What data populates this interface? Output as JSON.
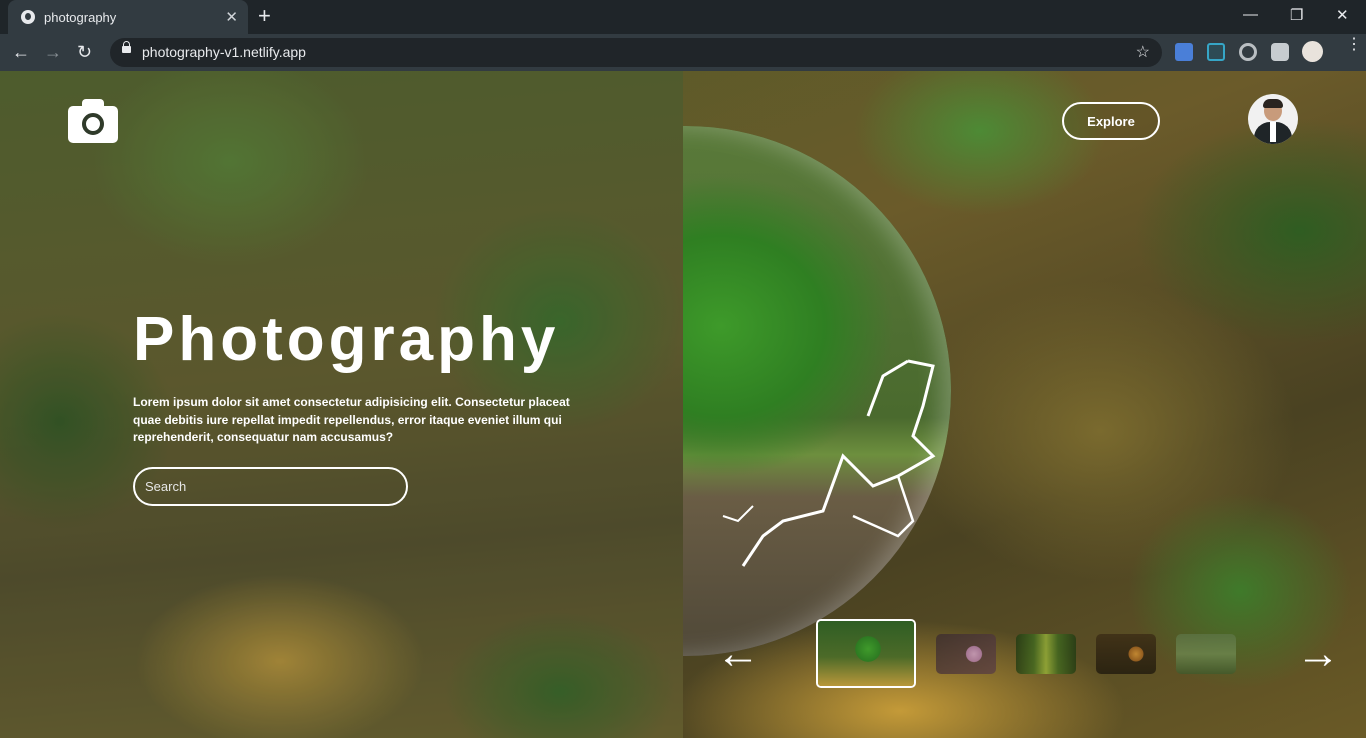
{
  "browser": {
    "tab_title": "photography",
    "url": "photography-v1.netlify.app",
    "new_tab": "+",
    "tab_close": "✕",
    "back": "←",
    "forward": "→",
    "reload": "↻",
    "bookmark": "☆",
    "minimize": "—",
    "restore": "❐",
    "close": "✕"
  },
  "hero": {
    "title": "Photography",
    "description": "Lorem ipsum dolor sit amet consectetur adipisicing elit. Consectetur placeat quae debitis iure repellat impedit repellendus, error itaque eveniet illum qui reprehenderit, consequatur nam accusamus?",
    "search_placeholder": "Search"
  },
  "nav": {
    "explore_label": "Explore"
  },
  "carousel": {
    "prev": "←",
    "next": "→",
    "thumbnails": [
      {
        "name": "tree-orb",
        "active": true
      },
      {
        "name": "flower",
        "active": false
      },
      {
        "name": "forest-road",
        "active": false
      },
      {
        "name": "sunset-tree",
        "active": false
      },
      {
        "name": "misty-field",
        "active": false
      }
    ]
  }
}
